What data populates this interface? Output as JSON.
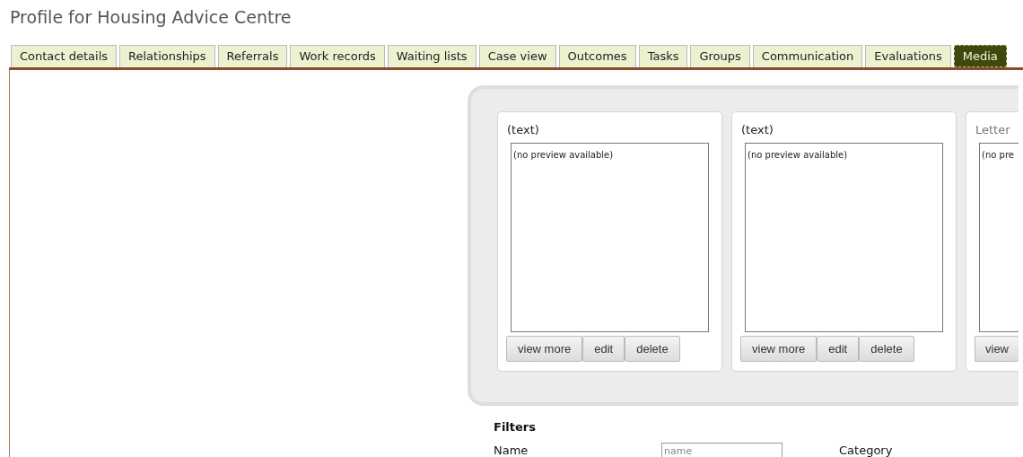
{
  "title": "Profile for Housing Advice Centre",
  "tabs": [
    {
      "label": "Contact details",
      "selected": false
    },
    {
      "label": "Relationships",
      "selected": false
    },
    {
      "label": "Referrals",
      "selected": false
    },
    {
      "label": "Work records",
      "selected": false
    },
    {
      "label": "Waiting lists",
      "selected": false
    },
    {
      "label": "Case view",
      "selected": false
    },
    {
      "label": "Outcomes",
      "selected": false
    },
    {
      "label": "Tasks",
      "selected": false
    },
    {
      "label": "Groups",
      "selected": false
    },
    {
      "label": "Communication",
      "selected": false
    },
    {
      "label": "Evaluations",
      "selected": false
    },
    {
      "label": "Media",
      "selected": true
    }
  ],
  "media_items": [
    {
      "title": "(text)",
      "kind": "plain",
      "preview": "(no preview available)",
      "buttons": [
        "view more",
        "edit",
        "delete"
      ]
    },
    {
      "title": "(text)",
      "kind": "plain",
      "preview": "(no preview available)",
      "buttons": [
        "view more",
        "edit",
        "delete"
      ]
    },
    {
      "title": "Letter",
      "kind": "link",
      "preview": "(no pre",
      "buttons": [
        "view"
      ]
    }
  ],
  "filters": {
    "heading": "Filters",
    "fields": [
      {
        "label": "Name",
        "placeholder": "name"
      }
    ],
    "column_3": "Category"
  }
}
